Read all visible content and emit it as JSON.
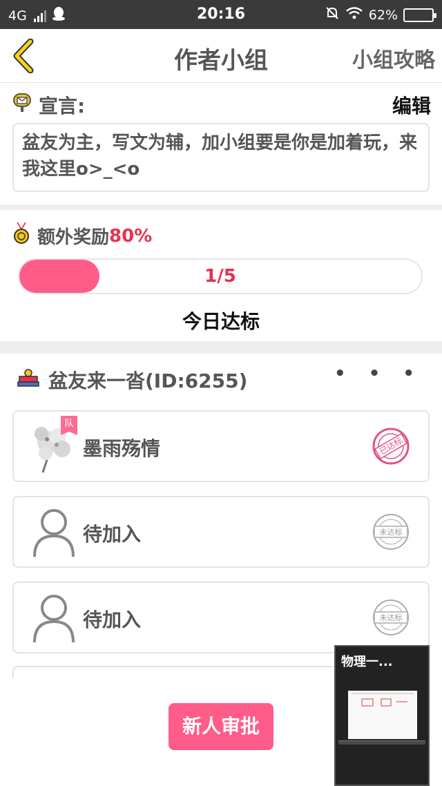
{
  "status_bar": {
    "network": "4G",
    "time": "20:16",
    "battery_percent": "62%",
    "battery_level": 0.62,
    "icons": [
      "signal-icon",
      "qq-icon",
      "silent-bell-icon",
      "wifi-icon",
      "battery-icon"
    ]
  },
  "header": {
    "title": "作者小组",
    "guide_label": "小组攻略",
    "back_icon": "chevron-left-icon"
  },
  "declaration": {
    "label": "宣言:",
    "edit_label": "编辑",
    "text": "盆友为主，写文为辅，加小组要是你是加着玩，来我这里o>_<o",
    "icon": "mailbox-icon"
  },
  "reward": {
    "label": "额外奖励",
    "percent": "80%",
    "progress_text": "1/5",
    "progress_value": 0.2,
    "status": "今日达标",
    "icon": "medal-icon",
    "accent_color": "#ff5c8a"
  },
  "group": {
    "name": "盆友来一沓(ID:6255)",
    "more_label": "• • •",
    "icon": "group-icon",
    "members": [
      {
        "name": "墨雨殇情",
        "badge": "队",
        "stamp": "已达标",
        "stamp_color": "#e0547e",
        "avatar": "flower-avatar"
      },
      {
        "name": "待加入",
        "stamp": "未达标",
        "stamp_color": "#9a9a9a",
        "avatar": "user-placeholder-icon"
      },
      {
        "name": "待加入",
        "stamp": "未达标",
        "stamp_color": "#9a9a9a",
        "avatar": "user-placeholder-icon"
      }
    ]
  },
  "approve_button": "新人审批",
  "floating_video": {
    "title": "物理一..."
  }
}
